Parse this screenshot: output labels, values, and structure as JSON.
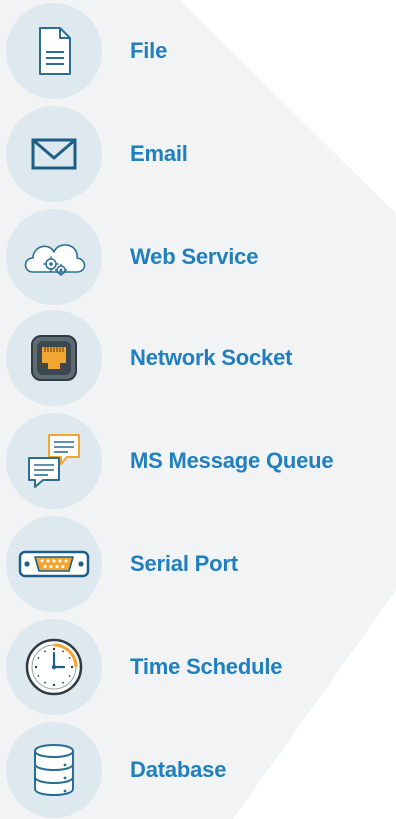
{
  "items": [
    {
      "label": "File",
      "icon": "file-icon"
    },
    {
      "label": "Email",
      "icon": "envelope-icon"
    },
    {
      "label": "Web Service",
      "icon": "cloud-gears-icon"
    },
    {
      "label": "Network Socket",
      "icon": "ethernet-port-icon"
    },
    {
      "label": "MS Message Queue",
      "icon": "chat-bubbles-icon"
    },
    {
      "label": "Serial Port",
      "icon": "serial-connector-icon"
    },
    {
      "label": "Time Schedule",
      "icon": "clock-icon"
    },
    {
      "label": "Database",
      "icon": "database-icon"
    }
  ],
  "colors": {
    "label": "#1f7fbf",
    "circle": "#dde9ef",
    "background_panel": "#f2f3f4",
    "icon_stroke": "#2a6f93",
    "accent_orange": "#f2a531"
  }
}
